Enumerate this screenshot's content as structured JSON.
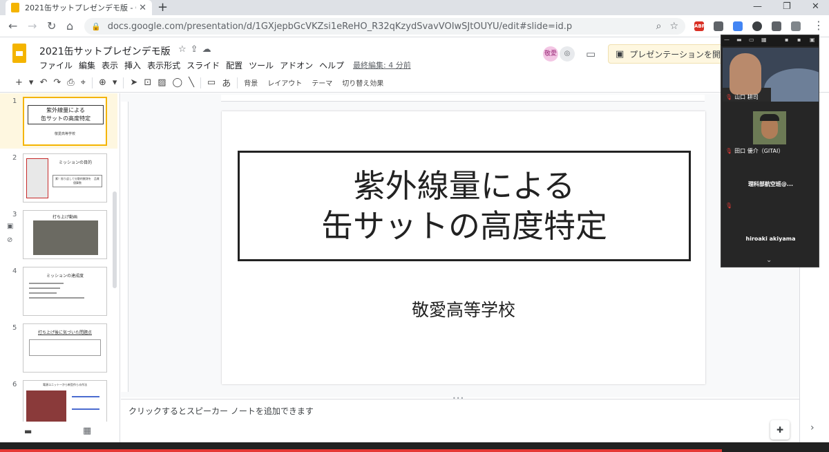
{
  "browser": {
    "tab_title": "2021缶サットプレゼンデモ版 - Goog",
    "tab_close": "✕",
    "new_tab": "+",
    "url": "docs.google.com/presentation/d/1GXjepbGcVKZsi1eReHO_R32qKzydSvavVOIwSJtOUYU/edit#slide=id.p",
    "win_min": "—",
    "win_max": "❐",
    "win_close": "✕",
    "ext_abp": "ABP"
  },
  "app": {
    "doc_title": "2021缶サットプレゼンデモ版",
    "menu": [
      "ファイル",
      "編集",
      "表示",
      "挿入",
      "表示形式",
      "スライド",
      "配置",
      "ツール",
      "アドオン",
      "ヘルプ"
    ],
    "last_edit": "最終編集: 4 分前",
    "avatar_k": "敬愛",
    "present_label": "プレゼンテーションを開始"
  },
  "toolbar": {
    "background": "背景",
    "layout": "レイアウト",
    "theme": "テーマ",
    "transition": "切り替え効果"
  },
  "filmstrip": {
    "slides": [
      {
        "num": "1",
        "line1": "紫外線量による",
        "line2": "缶サットの高度特定",
        "sub": "敬愛高等学校"
      },
      {
        "num": "2",
        "heading": "ミッションの目的",
        "body": "紫！振り返して分散的観測を　品質値算数"
      },
      {
        "num": "3",
        "heading": "打ち上げ動画"
      },
      {
        "num": "4",
        "heading": "ミッションの達成度"
      },
      {
        "num": "5",
        "heading": "打ち上げ後に気づいた問題点"
      },
      {
        "num": "6",
        "heading": "電源ユニット一から新型作らる作法"
      }
    ]
  },
  "slide": {
    "title_line1": "紫外線量による",
    "title_line2": "缶サットの高度特定",
    "subtitle": "敬愛高等学校"
  },
  "notes": {
    "placeholder": "クリックするとスピーカー ノートを追加できます"
  },
  "call": {
    "participants": [
      {
        "name": "山口 耕司"
      },
      {
        "name": "田口 優介（GITAI）"
      },
      {
        "name": "理科部航空班@..."
      },
      {
        "name": "hiroaki akiyama"
      }
    ]
  },
  "colors": {
    "slides_yellow": "#f4b400",
    "accent_red": "#e53935"
  }
}
